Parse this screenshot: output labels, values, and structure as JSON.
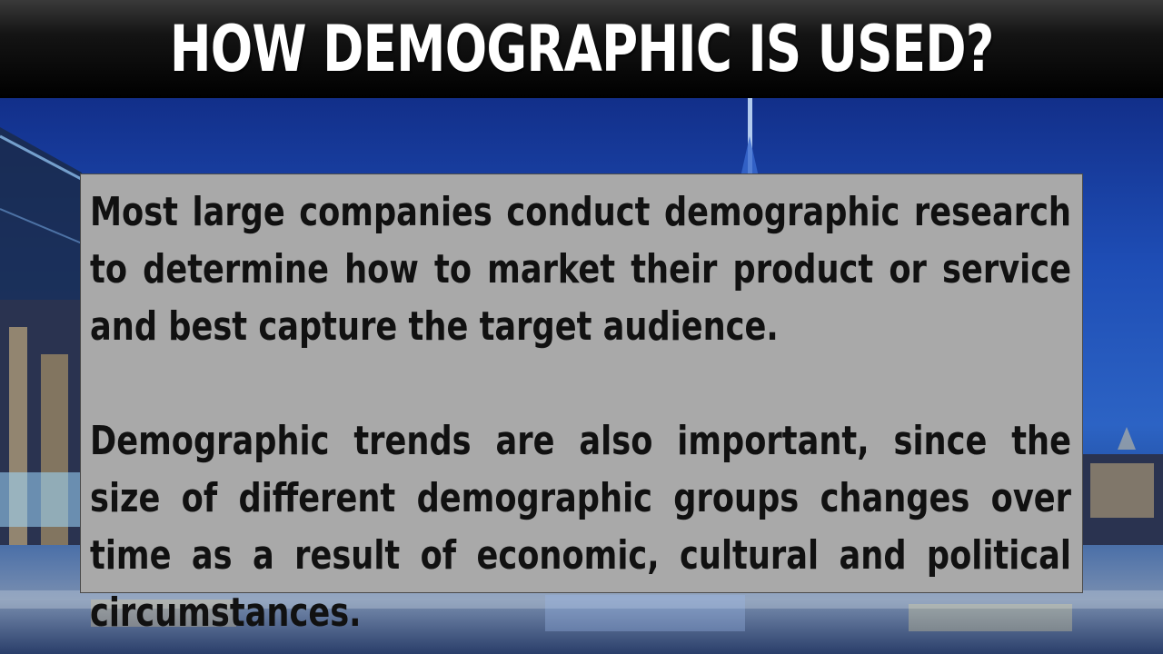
{
  "slide": {
    "title": "HOW DEMOGRAPHIC IS USED?",
    "paragraphs": [
      "Most large companies conduct demographic research to determine how to market their product or service and best capture the target audience.",
      "Demographic trends are also important, since the size of different demographic groups changes over time as a result of economic, cultural and political circumstances."
    ]
  },
  "colors": {
    "title_bar": "#000000",
    "title_text": "#ffffff",
    "content_box": "#a9a9a9",
    "body_text": "#111111"
  }
}
